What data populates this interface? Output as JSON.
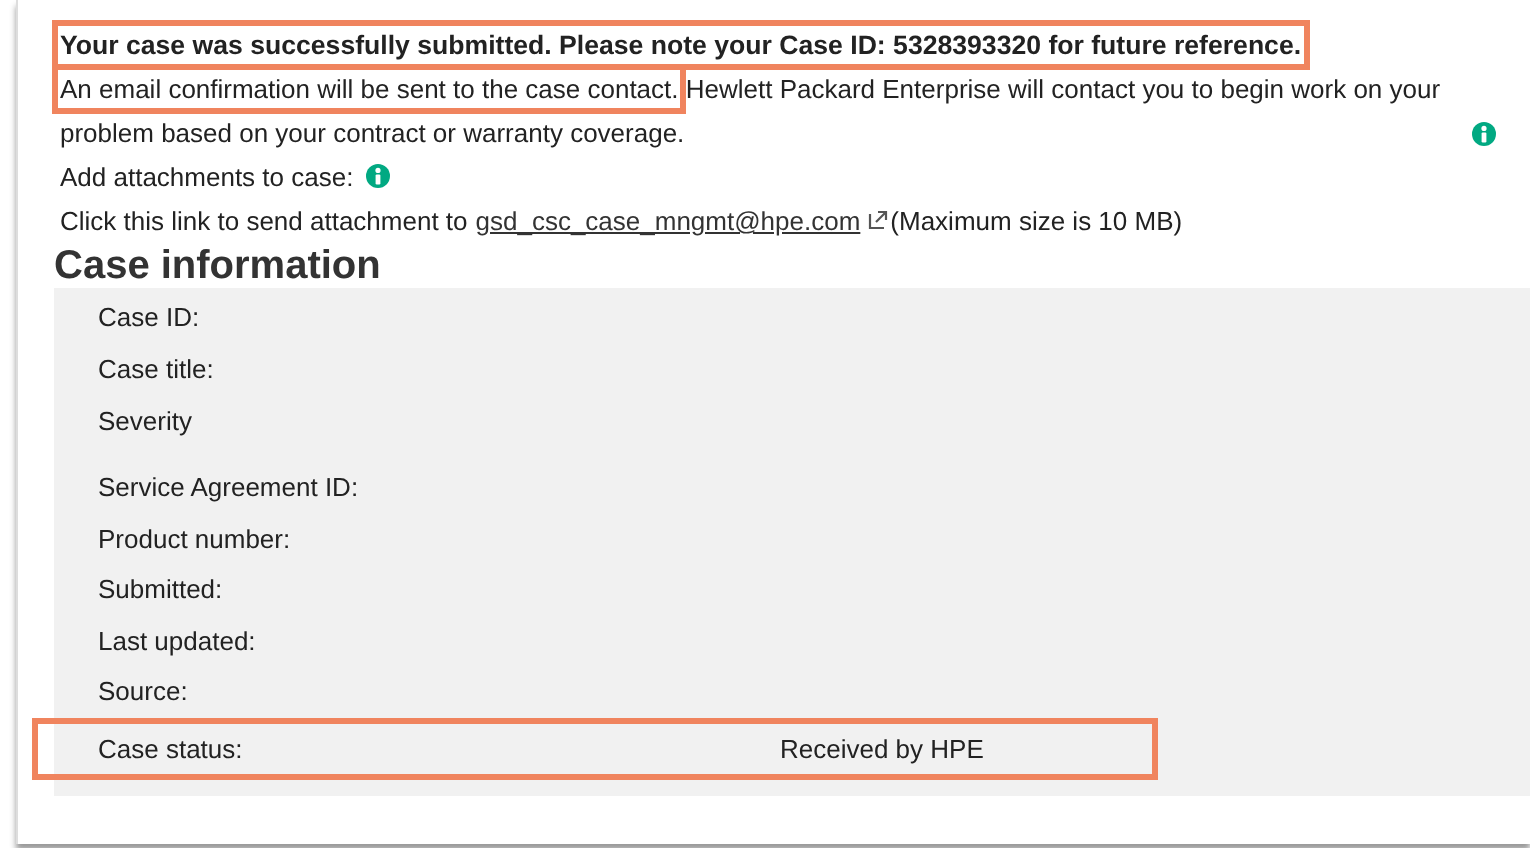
{
  "confirmation": {
    "text": "Your case was successfully submitted. Please note your Case ID: 5328393320 for future reference.",
    "highlighted": true
  },
  "notice": {
    "highlighted_part": "An email confirmation will be sent to the case contact.",
    "highlighted": true,
    "rest": "Hewlett Packard Enterprise will contact you to begin work on your problem based on your contract or warranty coverage."
  },
  "attachments": {
    "label": "Add attachments to case:"
  },
  "attachment_link": {
    "before": "Click this link to send attachment to",
    "link": "gsd_csc_case_mngmt@hpe.com",
    "after": "(Maximum size is 10 MB)"
  },
  "case_information": {
    "title": "Case information",
    "rows": [
      {
        "label": "Case ID:",
        "highlighted": false
      },
      {
        "label": "Case title:",
        "highlighted": false
      },
      {
        "label": "Severity",
        "highlighted": false
      },
      {
        "label": "Service Agreement ID:",
        "highlighted": false
      },
      {
        "label": "Product number:",
        "highlighted": false
      },
      {
        "label": "Submitted:",
        "highlighted": false
      },
      {
        "label": "Last updated:",
        "highlighted": false
      },
      {
        "label": "Source:",
        "highlighted": false
      },
      {
        "label": "Case status:",
        "value": "Received by HPE",
        "highlighted": true
      }
    ]
  }
}
